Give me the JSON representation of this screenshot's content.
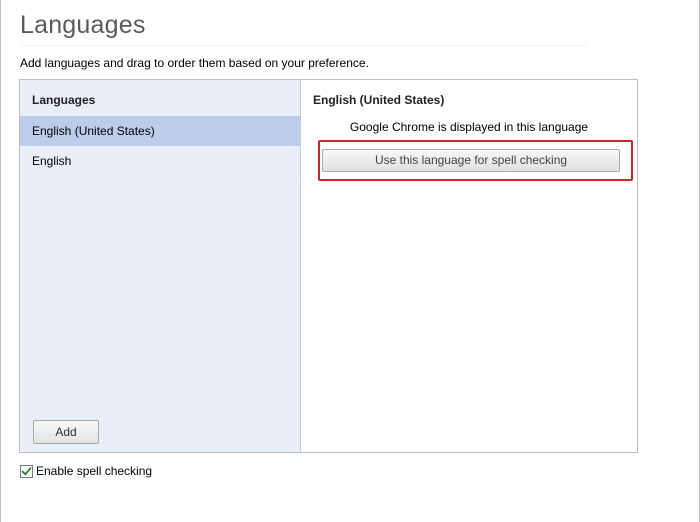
{
  "page": {
    "title": "Languages",
    "description": "Add languages and drag to order them based on your preference."
  },
  "left_pane": {
    "header": "Languages",
    "items": [
      {
        "label": "English (United States)",
        "selected": true
      },
      {
        "label": "English",
        "selected": false
      }
    ],
    "add_button_label": "Add"
  },
  "right_pane": {
    "header": "English (United States)",
    "display_note": "Google Chrome is displayed in this language",
    "spell_button_label": "Use this language for spell checking"
  },
  "footer": {
    "spell_check_label": "Enable spell checking",
    "spell_check_checked": true
  },
  "colors": {
    "highlight": "#d6202a",
    "selected_row": "#bccde9",
    "left_pane_bg": "#eaeef8"
  },
  "icons": {
    "checkbox_check": "check-icon"
  }
}
